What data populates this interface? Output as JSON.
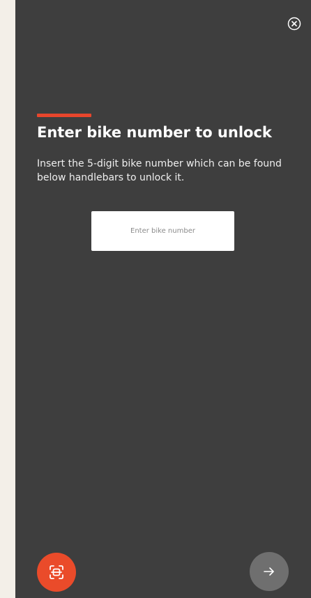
{
  "header": {
    "close_icon": "close-circle-icon"
  },
  "content": {
    "title": "Enter bike number to unlock",
    "description": "Insert the 5-digit bike number which can be found below handlebars to unlock it.",
    "accent_color": "#e8462c"
  },
  "input": {
    "value": "",
    "placeholder": "Enter bike number"
  },
  "actions": {
    "scan_icon": "qr-scan-icon",
    "scan_color": "#ea4b2a",
    "next_icon": "arrow-right-icon",
    "next_color": "#6f6f6f"
  },
  "colors": {
    "background": "#3e3e3e",
    "page_background": "#f3efe8"
  }
}
